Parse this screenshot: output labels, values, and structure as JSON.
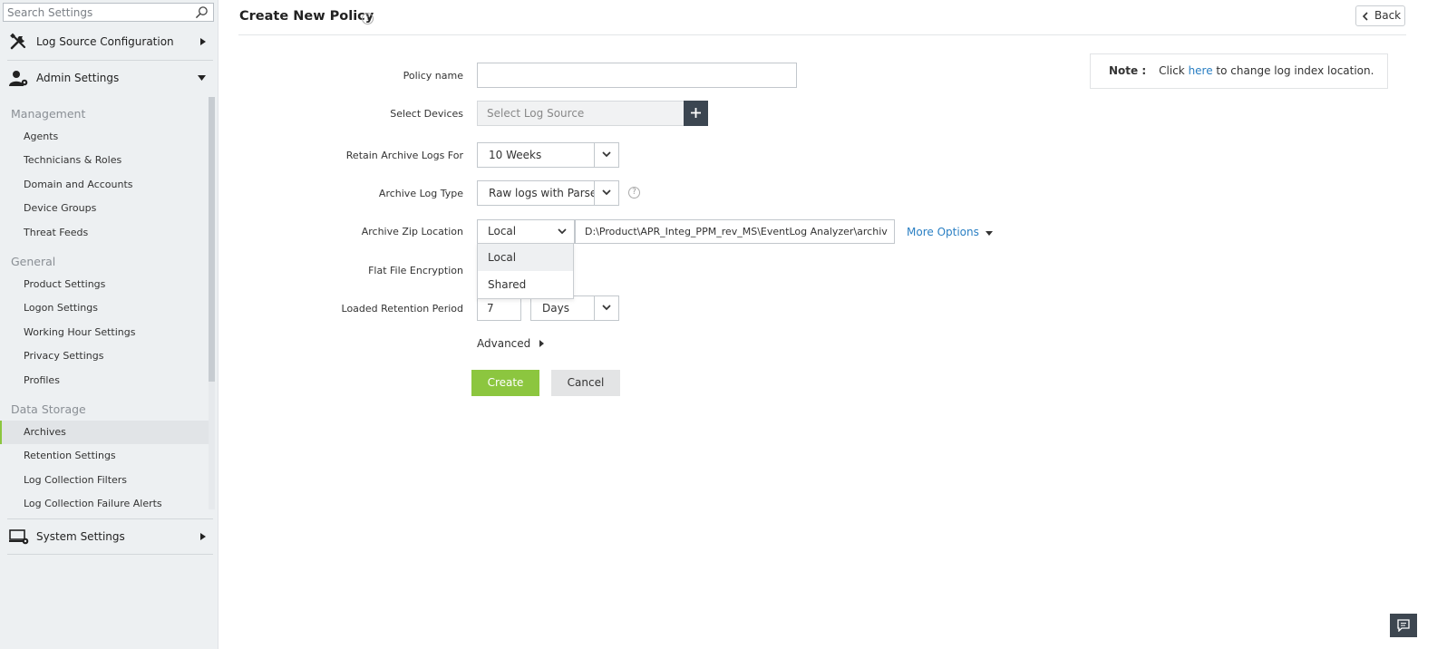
{
  "sidebar": {
    "search_placeholder": "Search Settings",
    "sections": [
      {
        "label": "Log Source Configuration",
        "icon": "tools-icon",
        "expanded": false
      },
      {
        "label": "Admin Settings",
        "icon": "user-gear-icon",
        "expanded": true
      },
      {
        "label": "System Settings",
        "icon": "monitor-gear-icon",
        "expanded": false
      }
    ],
    "groups": [
      {
        "title": "Management",
        "items": [
          "Agents",
          "Technicians & Roles",
          "Domain and Accounts",
          "Device Groups",
          "Threat Feeds"
        ]
      },
      {
        "title": "General",
        "items": [
          "Product Settings",
          "Logon Settings",
          "Working Hour Settings",
          "Privacy Settings",
          "Profiles"
        ]
      },
      {
        "title": "Data Storage",
        "items": [
          "Archives",
          "Retention Settings",
          "Log Collection Filters",
          "Log Collection Failure Alerts"
        ]
      }
    ],
    "active_item": "Archives"
  },
  "header": {
    "title": "Create New Policy",
    "help_glyph": "?",
    "back_label": "Back"
  },
  "note": {
    "label": "Note :",
    "prefix": "Click ",
    "link": "here",
    "suffix": " to change log index location."
  },
  "form": {
    "policy_name": {
      "label": "Policy name",
      "value": ""
    },
    "select_devices": {
      "label": "Select Devices",
      "placeholder": "Select Log Source"
    },
    "retain": {
      "label": "Retain Archive Logs For",
      "value": "10 Weeks"
    },
    "log_type": {
      "label": "Archive Log Type",
      "value": "Raw logs with Parsed"
    },
    "zip_location": {
      "label": "Archive Zip Location",
      "value": "Local",
      "path": "D:\\Product\\APR_Integ_PPM_rev_MS\\EventLog Analyzer\\archiv",
      "options": [
        "Local",
        "Shared"
      ],
      "more_options": "More Options"
    },
    "flat_file": {
      "label": "Flat File Encryption"
    },
    "loaded_retention": {
      "label": "Loaded Retention Period",
      "value": "7",
      "unit": "Days"
    },
    "advanced": "Advanced",
    "create": "Create",
    "cancel": "Cancel"
  },
  "colors": {
    "accent_green": "#8cc63f",
    "link_blue": "#2a7fc3",
    "dark_button": "#3c4651",
    "sidebar_bg": "#edf0f2"
  }
}
